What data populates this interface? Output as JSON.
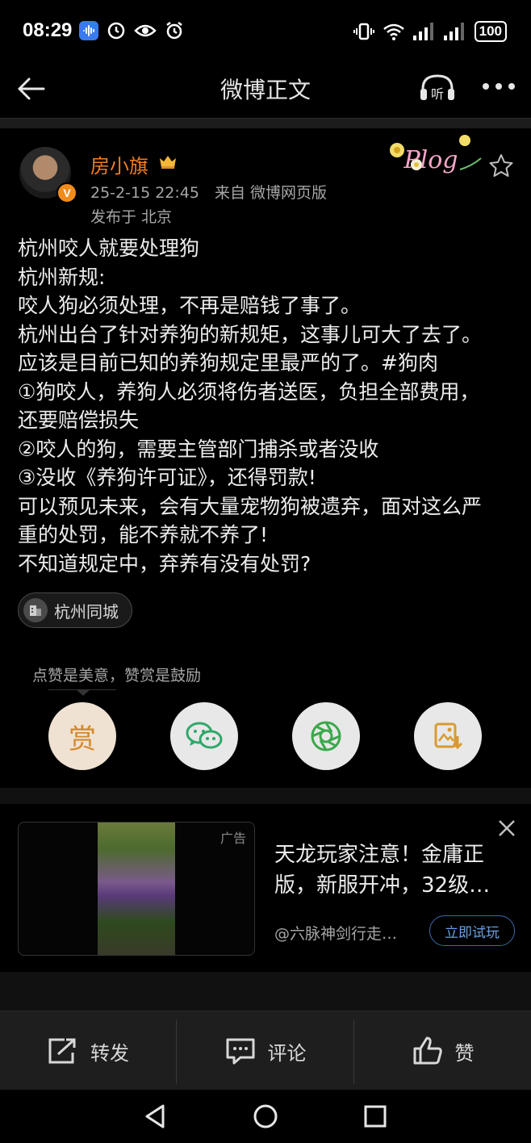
{
  "status_bar": {
    "time": "08:29",
    "battery": "100",
    "icons_left": [
      "soundwave-app-icon",
      "clock-icon",
      "eye-icon",
      "alarm-icon"
    ],
    "icons_right": [
      "vibrate-icon",
      "wifi-icon",
      "signal-icon",
      "signal-icon"
    ]
  },
  "nav": {
    "title": "微博正文",
    "listen_label": "听"
  },
  "post": {
    "username": "房小旗",
    "meta": "25-2-15 22:45　来自 微博网页版",
    "location": "发布于 北京",
    "badge": "Plog",
    "verified_mark": "V",
    "body_lines": [
      "杭州咬人就要处理狗",
      "杭州新规:",
      "咬人狗必须处理，不再是赔钱了事了。",
      "杭州出台了针对养狗的新规矩，这事儿可大了去了。",
      "应该是目前已知的养狗规定里最严的了。#狗肉",
      "①狗咬人，养狗人必须将伤者送医，负担全部费用，",
      "还要赔偿损失",
      "②咬人的狗，需要主管部门捕杀或者没收",
      "③没收《养狗许可证》，还得罚款!",
      "可以预见未来，会有大量宠物狗被遗弃，面对这么严",
      "重的处罚，能不养就不养了!",
      "不知道规定中，弃养有没有处罚?"
    ],
    "topic": "杭州同城"
  },
  "reward": {
    "tip": "点赞是美意，赞赏是鼓励",
    "reward_label": "赏"
  },
  "ad": {
    "tag": "广告",
    "title": "天龙玩家注意！金庸正版，新服开冲，32级…",
    "source": "@六脉神剑行走…",
    "cta": "立即试玩"
  },
  "actions": {
    "repost": "转发",
    "comment": "评论",
    "like": "赞"
  },
  "colors": {
    "accent_orange": "#f07e22",
    "link_blue": "#6aa0e0",
    "background": "#000000"
  }
}
